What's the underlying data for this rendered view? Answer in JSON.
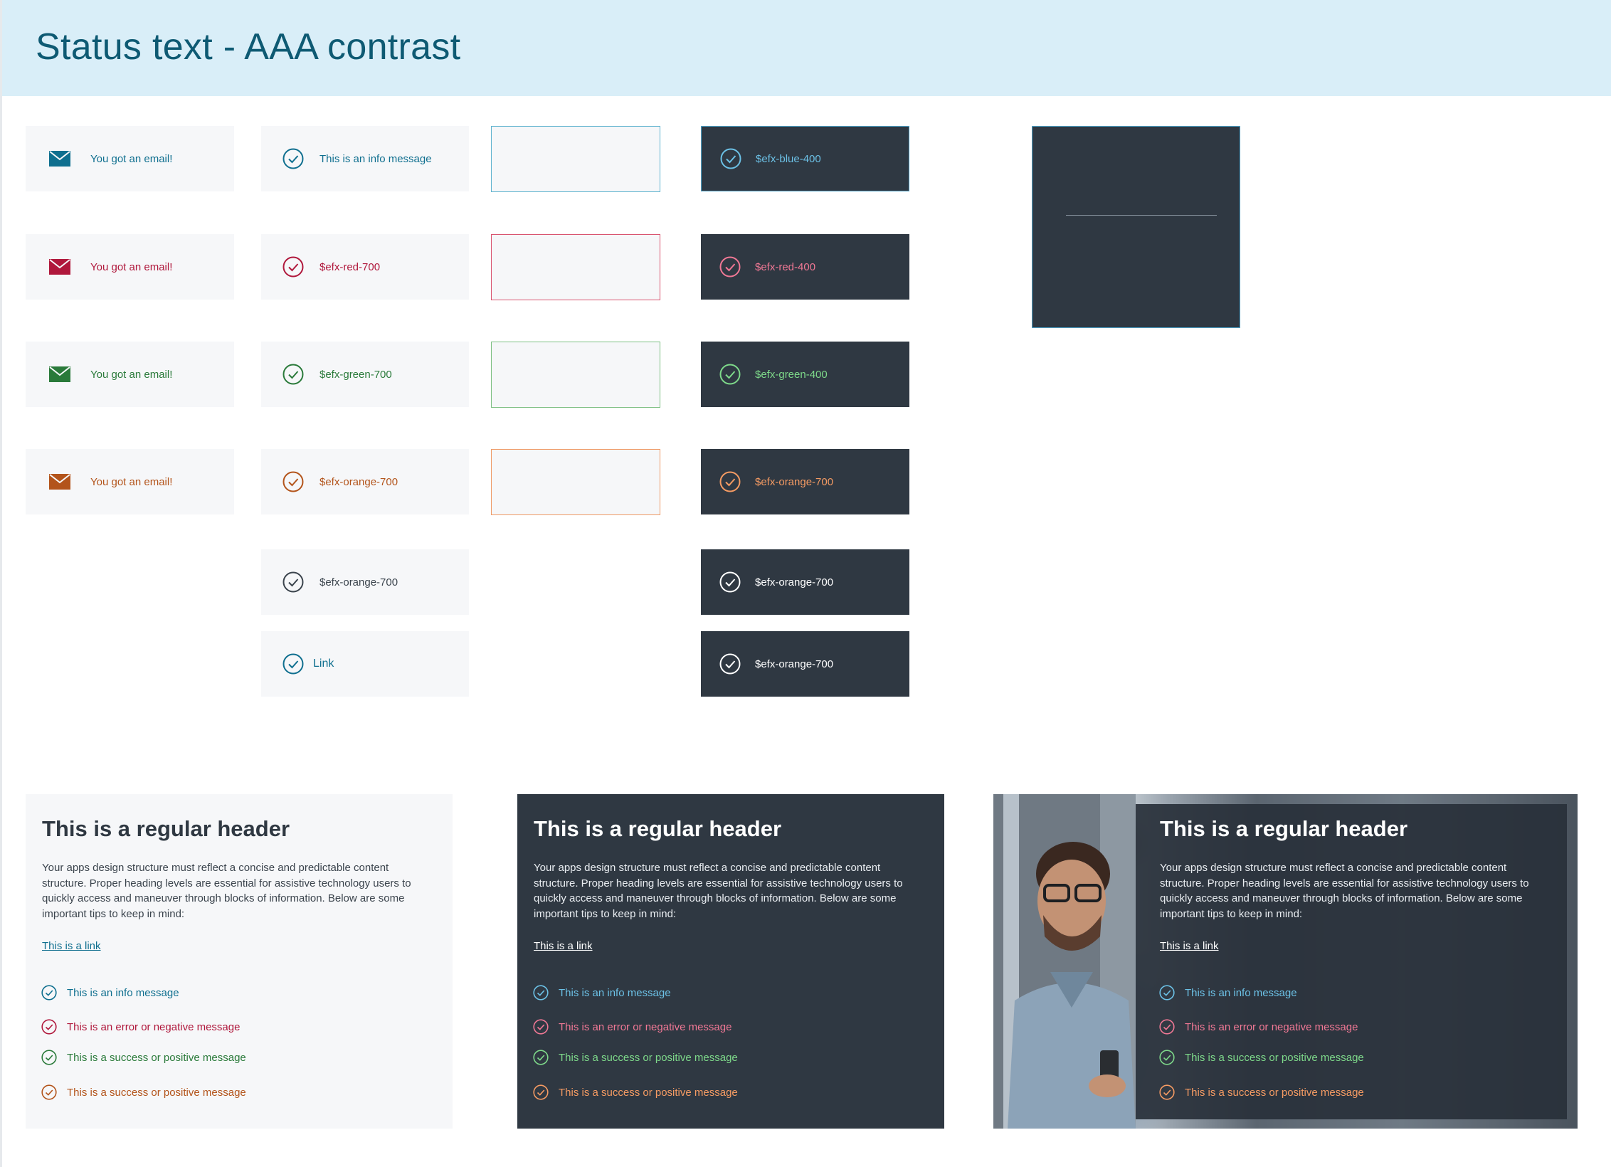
{
  "page": {
    "title": "Status text - AAA contrast"
  },
  "colors": {
    "blue_700": "#0f6f8f",
    "red_700": "#b0183c",
    "green_700": "#2a7a3a",
    "orange_700": "#b3541b",
    "grey_700": "#3b444d",
    "blue_400": "#6cc1e6",
    "red_400": "#f07895",
    "green_400": "#7ed98a",
    "orange_400": "#f59b63",
    "white": "#ffffff",
    "dark_bg": "#2f3842",
    "light_bg": "#f6f7f9"
  },
  "email_tiles": [
    {
      "icon": "envelope-icon",
      "label": "You got an email!",
      "color": "#0f6f8f"
    },
    {
      "icon": "envelope-icon",
      "label": "You got an email!",
      "color": "#b0183c"
    },
    {
      "icon": "envelope-icon",
      "label": "You got an email!",
      "color": "#2a7a3a"
    },
    {
      "icon": "envelope-icon",
      "label": "You got an email!",
      "color": "#b3541b"
    }
  ],
  "light_check_tiles": [
    {
      "icon": "check-circle-icon",
      "label": "This is an info message",
      "color": "#0f6f8f"
    },
    {
      "icon": "check-circle-icon",
      "label": "$efx-red-700",
      "color": "#b0183c"
    },
    {
      "icon": "check-circle-icon",
      "label": "$efx-green-700",
      "color": "#2a7a3a"
    },
    {
      "icon": "check-circle-icon",
      "label": "$efx-orange-700",
      "color": "#b3541b"
    },
    {
      "icon": "check-circle-icon",
      "label": "$efx-orange-700",
      "color": "#3b444d"
    },
    {
      "icon": "check-circle-icon",
      "label": "Link",
      "color": "#0f6f8f"
    }
  ],
  "outline_boxes": [
    {
      "color": "#5fb3cf"
    },
    {
      "color": "#d9546f"
    },
    {
      "color": "#7cbf82"
    },
    {
      "color": "#ef9a66"
    }
  ],
  "dark_check_tiles": [
    {
      "icon": "check-circle-icon",
      "label": "$efx-blue-400",
      "color": "#6cc1e6"
    },
    {
      "icon": "check-circle-icon",
      "label": "$efx-red-400",
      "color": "#f07895"
    },
    {
      "icon": "check-circle-icon",
      "label": "$efx-green-400",
      "color": "#7ed98a"
    },
    {
      "icon": "check-circle-icon",
      "label": "$efx-orange-700",
      "color": "#f59b63"
    },
    {
      "icon": "check-circle-icon",
      "label": "$efx-orange-700",
      "color": "#ffffff"
    },
    {
      "icon": "check-circle-icon",
      "label": "$efx-orange-700",
      "color": "#ffffff"
    }
  ],
  "cards": [
    {
      "variant": "light",
      "header": "This is a regular header",
      "body": "Your apps design structure must reflect a concise and predictable content structure. Proper heading levels are essential for assistive technology users to quickly access and maneuver through blocks of information. Below are some important tips to keep in mind:",
      "link": "This is a link",
      "messages": [
        {
          "label": "This is an info message",
          "color": "#0f6f8f"
        },
        {
          "label": "This is an error or negative message",
          "color": "#b0183c"
        },
        {
          "label": "This is a success or positive message",
          "color": "#2a7a3a"
        },
        {
          "label": "This is a success or positive message",
          "color": "#b3541b"
        }
      ]
    },
    {
      "variant": "dark",
      "header": "This is a regular header",
      "body": "Your apps design structure must reflect a concise and predictable content structure. Proper heading levels are essential for assistive technology users to quickly access and maneuver through blocks of information. Below are some important tips to keep in mind:",
      "link": "This is a link",
      "messages": [
        {
          "label": "This is an info message",
          "color": "#6cc1e6"
        },
        {
          "label": "This is an error or negative message",
          "color": "#f07895"
        },
        {
          "label": "This is a success or positive message",
          "color": "#7ed98a"
        },
        {
          "label": "This is a success or positive message",
          "color": "#f59b63"
        }
      ]
    },
    {
      "variant": "photo",
      "header": "This is a regular header",
      "body": "Your apps design structure must reflect a concise and predictable content structure. Proper heading levels are essential for assistive technology users to quickly access and maneuver through blocks of information. Below are some important tips to keep in mind:",
      "link": "This is a link",
      "messages": [
        {
          "label": "This is an info message",
          "color": "#6cc1e6"
        },
        {
          "label": "This is an error or negative message",
          "color": "#f07895"
        },
        {
          "label": "This is a success or positive message",
          "color": "#7ed98a"
        },
        {
          "label": "This is a success or positive message",
          "color": "#f59b63"
        }
      ]
    }
  ]
}
